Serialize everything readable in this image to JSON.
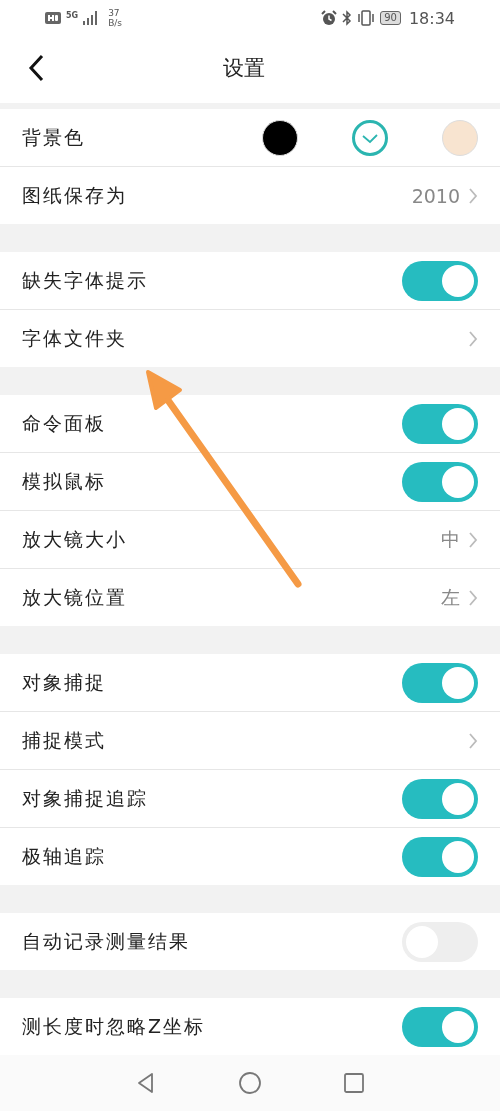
{
  "status_bar": {
    "network": "5G",
    "speed_value": "37",
    "speed_unit": "B/s",
    "battery": "90",
    "time": "18:34"
  },
  "header": {
    "title": "设置"
  },
  "sections": [
    {
      "rows": [
        {
          "kind": "colors",
          "label": "背景色",
          "swatches": [
            {
              "color": "#000000",
              "selected": false
            },
            {
              "color": "#ffffff",
              "selected": true
            },
            {
              "color": "#f8e4d0",
              "selected": false
            }
          ]
        },
        {
          "kind": "value",
          "label": "图纸保存为",
          "value": "2010"
        }
      ]
    },
    {
      "rows": [
        {
          "kind": "toggle",
          "label": "缺失字体提示",
          "on": true
        },
        {
          "kind": "link",
          "label": "字体文件夹"
        }
      ]
    },
    {
      "rows": [
        {
          "kind": "toggle",
          "label": "命令面板",
          "on": true
        },
        {
          "kind": "toggle",
          "label": "模拟鼠标",
          "on": true
        },
        {
          "kind": "value",
          "label": "放大镜大小",
          "value": "中"
        },
        {
          "kind": "value",
          "label": "放大镜位置",
          "value": "左"
        }
      ]
    },
    {
      "rows": [
        {
          "kind": "toggle",
          "label": "对象捕捉",
          "on": true
        },
        {
          "kind": "link",
          "label": "捕捉模式"
        },
        {
          "kind": "toggle",
          "label": "对象捕捉追踪",
          "on": true
        },
        {
          "kind": "toggle",
          "label": "极轴追踪",
          "on": true
        }
      ]
    },
    {
      "rows": [
        {
          "kind": "toggle",
          "label": "自动记录测量结果",
          "on": false
        }
      ]
    },
    {
      "rows": [
        {
          "kind": "toggle",
          "label": "测长度时忽略Z坐标",
          "on": true
        }
      ]
    }
  ]
}
